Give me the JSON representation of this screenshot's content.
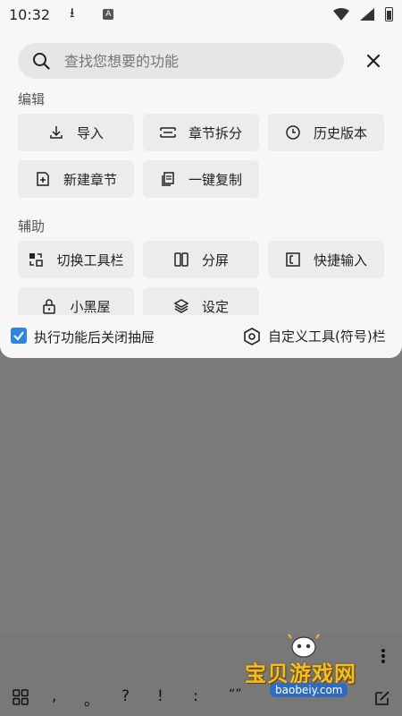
{
  "status_bar": {
    "time": "10:32",
    "download_icon": "download-icon",
    "a_badge": "A"
  },
  "search": {
    "placeholder": "查找您想要的功能"
  },
  "sections": {
    "edit": {
      "title": "编辑",
      "buttons": [
        {
          "label": "导入",
          "icon": "import-icon"
        },
        {
          "label": "章节拆分",
          "icon": "split-icon"
        },
        {
          "label": "历史版本",
          "icon": "history-icon"
        },
        {
          "label": "新建章节",
          "icon": "new-chapter-icon"
        },
        {
          "label": "一键复制",
          "icon": "copy-icon"
        }
      ]
    },
    "assist": {
      "title": "辅助",
      "buttons": [
        {
          "label": "切换工具栏",
          "icon": "switch-toolbar-icon"
        },
        {
          "label": "分屏",
          "icon": "split-screen-icon"
        },
        {
          "label": "快捷输入",
          "icon": "quick-input-icon"
        },
        {
          "label": "小黑屋",
          "icon": "lock-icon"
        },
        {
          "label": "设定",
          "icon": "layers-icon"
        }
      ]
    }
  },
  "footer": {
    "close_after_label": "执行功能后关闭抽屉",
    "close_after_checked": true,
    "custom_toolbar_label": "自定义工具(符号)栏"
  },
  "keyboard_bar": {
    "keys": [
      ",",
      "。",
      "?",
      "!",
      ":",
      "“”"
    ]
  },
  "watermark": {
    "title": "宝贝游戏网",
    "url": "baobeiy.com"
  },
  "colors": {
    "accent": "#2e86de",
    "panel_bg": "#f7f7f7",
    "button_bg": "#ececec",
    "overlay": "#7b7b7b"
  }
}
